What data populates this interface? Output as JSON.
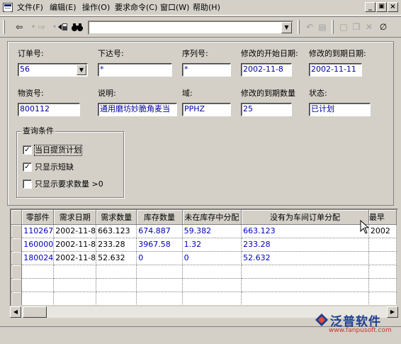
{
  "menu": {
    "items": [
      "文件(F)",
      "编辑(E)",
      "操作(O)",
      "要求命令(C)",
      "窗口(W)",
      "帮助(H)"
    ],
    "window_buttons": [
      "_",
      "&#x1F5D7;",
      "×"
    ]
  },
  "toolbar": {
    "combo_value": "",
    "icons": [
      "back-arrow-icon",
      "forward-arrow-icon",
      "next-record-icon",
      "binoculars-icon",
      "undo-icon",
      "save-icon",
      "new-doc-icon",
      "copy-icon",
      "delete-icon",
      "eraser-icon"
    ]
  },
  "form": {
    "order_no_label": "订单号:",
    "order_no_value": "56",
    "issue_no_label": "下达号:",
    "issue_no_value": "*",
    "seq_no_label": "序列号:",
    "seq_no_value": "*",
    "start_date_label": "修改的开始日期:",
    "start_date_value": "2002-11-8",
    "due_date_label": "修改的到期日期:",
    "due_date_value": "2002-11-11",
    "item_no_label": "物资号:",
    "item_no_value": "800112",
    "desc_label": "说明:",
    "desc_value": "通用磨坊妙脆角麦当",
    "domain_label": "域:",
    "domain_value": "PPHZ",
    "due_qty_label": "修改的到期数量",
    "due_qty_value": "25",
    "status_label": "状态:",
    "status_value": "已计划"
  },
  "query": {
    "title": "查询条件",
    "options": [
      {
        "label": "当日提货计划",
        "checked": true
      },
      {
        "label": "只显示短缺",
        "checked": true
      },
      {
        "label": "只显示要求数量 >0",
        "checked": false
      }
    ]
  },
  "grid": {
    "columns": [
      "零部件",
      "需求日期",
      "需求数量",
      "库存数量",
      "未在库存中分配",
      "没有为车间订单分配",
      "最早"
    ],
    "rows": [
      [
        "110267",
        "2002-11-8",
        "663.123",
        "674.887",
        "59.382",
        "663.123",
        "2002"
      ],
      [
        "160000",
        "2002-11-8",
        "233.28",
        "3967.58",
        "1.32",
        "233.28",
        ""
      ],
      [
        "180024",
        "2002-11-8",
        "52.632",
        "0",
        "0",
        "52.632",
        ""
      ]
    ]
  },
  "watermark": {
    "name": "泛普软件",
    "url": "www.fanpusoft.com"
  }
}
